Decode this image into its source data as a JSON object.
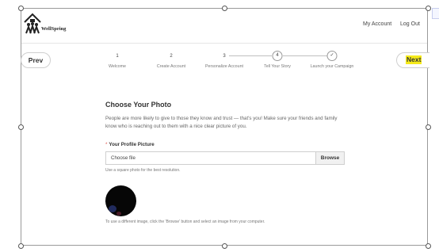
{
  "brand": {
    "name": "WellSpring"
  },
  "header": {
    "nav": [
      {
        "label": "My Account"
      },
      {
        "label": "Log Out"
      }
    ]
  },
  "wizard": {
    "prev_label": "Prev",
    "next_label": "Next",
    "steps": [
      {
        "number": "1",
        "label": "Welcome"
      },
      {
        "number": "2",
        "label": "Create Account"
      },
      {
        "number": "3",
        "label": "Personalize Account"
      },
      {
        "number": "4",
        "label": "Tell Your Story"
      },
      {
        "number": "✓",
        "label": "Launch your Campaign"
      }
    ]
  },
  "photo": {
    "title": "Choose Your Photo",
    "description": "People are more likely to give to those they know and trust — that's you! Make sure your friends and family know who is reaching out to them with a nice clear picture of you.",
    "required_marker": "*",
    "field_label": "Your Profile Picture",
    "file_value": "Choose file",
    "browse_label": "Browse",
    "hint": "Use a square photo for the best resolution.",
    "note": "To use a different image, click the 'Browse' button and select an image from your computer."
  },
  "colors": {
    "next_highlight": "#f5ea1a",
    "required": "#e0534a",
    "avatar": "#060606"
  }
}
